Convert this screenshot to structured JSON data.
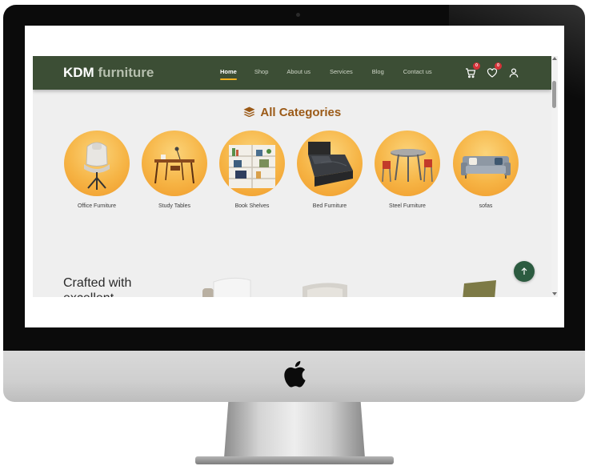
{
  "site": {
    "brand_main": "KDM",
    "brand_sub": "furniture"
  },
  "nav": {
    "links": [
      {
        "label": "Home",
        "active": true
      },
      {
        "label": "Shop",
        "active": false
      },
      {
        "label": "About us",
        "active": false
      },
      {
        "label": "Services",
        "active": false
      },
      {
        "label": "Blog",
        "active": false
      },
      {
        "label": "Contact us",
        "active": false
      }
    ],
    "cart_count": "0",
    "wishlist_count": "0",
    "icons": [
      "cart-icon",
      "heart-icon",
      "user-icon"
    ]
  },
  "categories": {
    "title": "All Categories",
    "icon": "layers-icon",
    "items": [
      {
        "label": "Office Furniture"
      },
      {
        "label": "Study Tables"
      },
      {
        "label": "Book Shelves"
      },
      {
        "label": "Bed Furniture"
      },
      {
        "label": "Steel Furniture"
      },
      {
        "label": "sofas"
      }
    ]
  },
  "hero2": {
    "heading_line1": "Crafted with",
    "heading_line2": "excellent"
  },
  "colors": {
    "navbar": "#3c4e35",
    "accent": "#f2b01e",
    "category_title": "#9b5a17",
    "circle": "#f6b445",
    "back_to_top": "#2c5b40",
    "badge": "#d6333a"
  }
}
